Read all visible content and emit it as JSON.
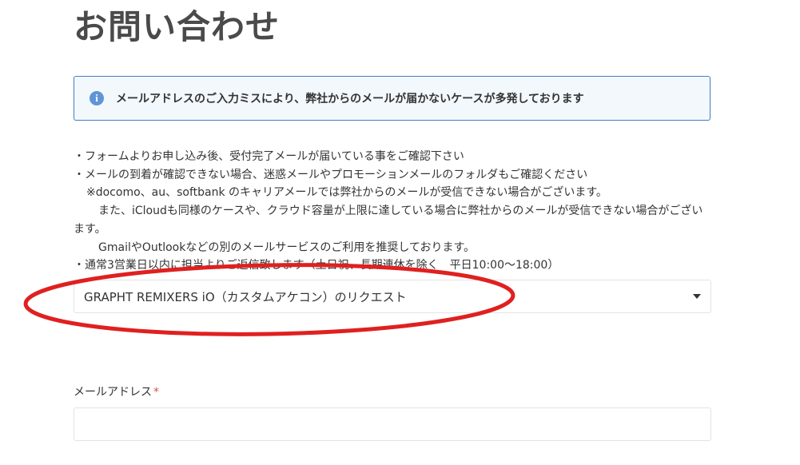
{
  "page": {
    "title": "お問い合わせ"
  },
  "notice": {
    "icon": "info-icon",
    "icon_glyph": "i",
    "text": "メールアドレスのご入力ミスにより、弊社からのメールが届かないケースが多発しております",
    "border_color": "#3f7fc3",
    "background_color": "#f3f8fd"
  },
  "guide": {
    "lines": [
      "・フォームよりお申し込み後、受付完了メールが届いている事をご確認下さい",
      "・メールの到着が確認できない場合、迷惑メールやプロモーションメールのフォルダもご確認ください",
      "※docomo、au、softbank のキャリアメールでは弊社からのメールが受信できない場合がございます。",
      "また、iCloudも同様のケースや、クラウド容量が上限に達している場合に弊社からのメールが受信できない場合がございます。",
      "GmailやOutlookなどの別のメールサービスのご利用を推奨しております。",
      "・通常3営業日以内に担当よりご返信致します（土日祝、長期連休を除く　平日10:00〜18:00）"
    ]
  },
  "inquiry_select": {
    "selected": "GRAPHT REMIXERS iO（カスタムアケコン）のリクエスト",
    "icon": "caret-down-icon"
  },
  "annotation": {
    "shape": "ellipse",
    "color": "#e02020"
  },
  "email": {
    "label": "メールアドレス",
    "required_mark": "*",
    "value": "",
    "placeholder": ""
  }
}
